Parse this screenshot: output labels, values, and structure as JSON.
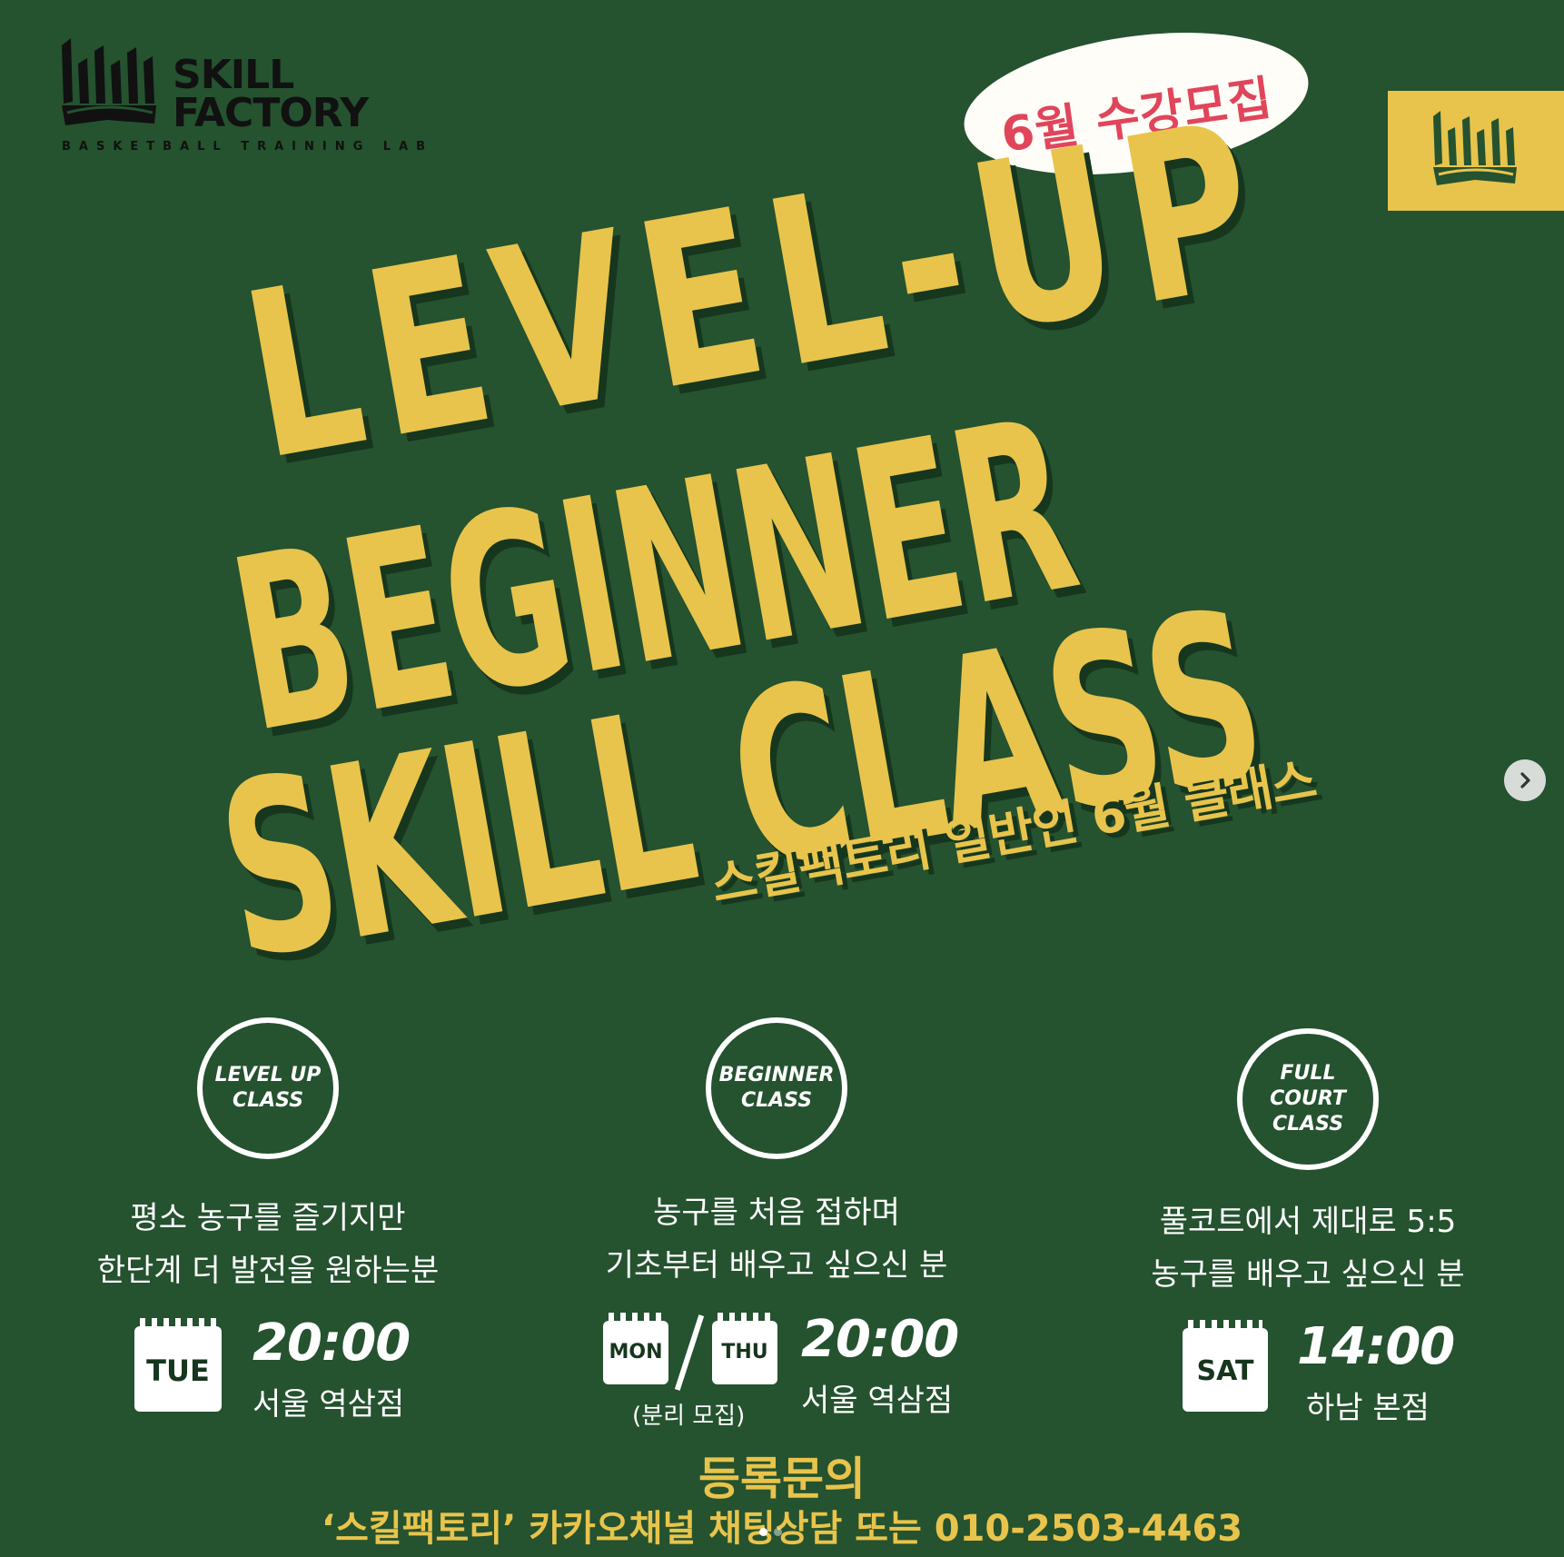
{
  "brand": {
    "logo_line1": "SKILL",
    "logo_line2": "FACTORY",
    "tagline": "BASKETBALL TRAINING LAB"
  },
  "badge": "6월 수강모집",
  "headline": {
    "line1": "LEVEL-UP",
    "line2": "BEGINNER",
    "line3": "SKILL CLASS",
    "subtitle": "스킬팩토리 일반인 6월 클래스"
  },
  "classes": [
    {
      "circle_line1": "LEVEL UP",
      "circle_line2": "CLASS",
      "desc_line1": "평소 농구를 즐기지만",
      "desc_line2": "한단계 더 발전을 원하는분",
      "day": "TUE",
      "time": "20:00",
      "location": "서울 역삼점"
    },
    {
      "circle_line1": "BEGINNER",
      "circle_line2": "CLASS",
      "desc_line1": "농구를 처음 접하며",
      "desc_line2": "기초부터 배우고 싶으신 분",
      "day1": "MON",
      "day2": "THU",
      "note": "(분리 모집)",
      "time": "20:00",
      "location": "서울 역삼점"
    },
    {
      "circle_line1": "FULL COURT",
      "circle_line2": "CLASS",
      "desc_line1": "풀코트에서 제대로 5:5",
      "desc_line2": "농구를 배우고 싶으신 분",
      "day": "SAT",
      "time": "14:00",
      "location": "하남 본점"
    }
  ],
  "footer": {
    "title": "등록문의",
    "contact": "‘스킬팩토리’ 카카오채널 채팅상담  또는 010-2503-4463"
  },
  "carousel": {
    "next_icon": "chevron-right-icon",
    "active_index": 1,
    "count": 2
  },
  "colors": {
    "background": "#25522f",
    "accent_yellow": "#e8c44c",
    "badge_red": "#e0455b"
  }
}
